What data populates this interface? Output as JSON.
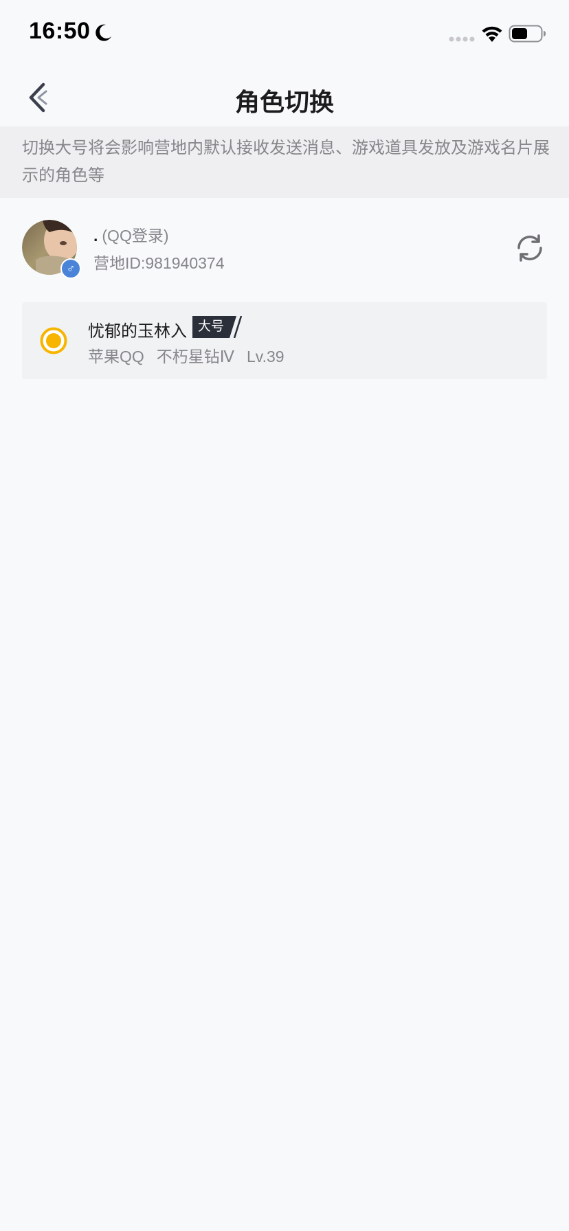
{
  "status_bar": {
    "time": "16:50"
  },
  "nav": {
    "title": "角色切换"
  },
  "notice": {
    "text": "切换大号将会影响营地内默认接收发送消息、游戏道具发放及游戏名片展示的角色等"
  },
  "account": {
    "name": ".",
    "login_type": "(QQ登录)",
    "camp_id": "营地ID:981940374",
    "gender_symbol": "♂",
    "gender_color": "#4a84d8"
  },
  "roles": [
    {
      "name": "忧郁的玉林入",
      "badge": "大号",
      "platform": "苹果QQ",
      "rank": "不朽星钻Ⅳ",
      "level": "Lv.39",
      "selected": true
    }
  ],
  "colors": {
    "accent_radio": "#f7b500",
    "badge_bg": "#2b2f3a",
    "secondary_text": "#86868b",
    "banner_bg": "#efeff1"
  }
}
